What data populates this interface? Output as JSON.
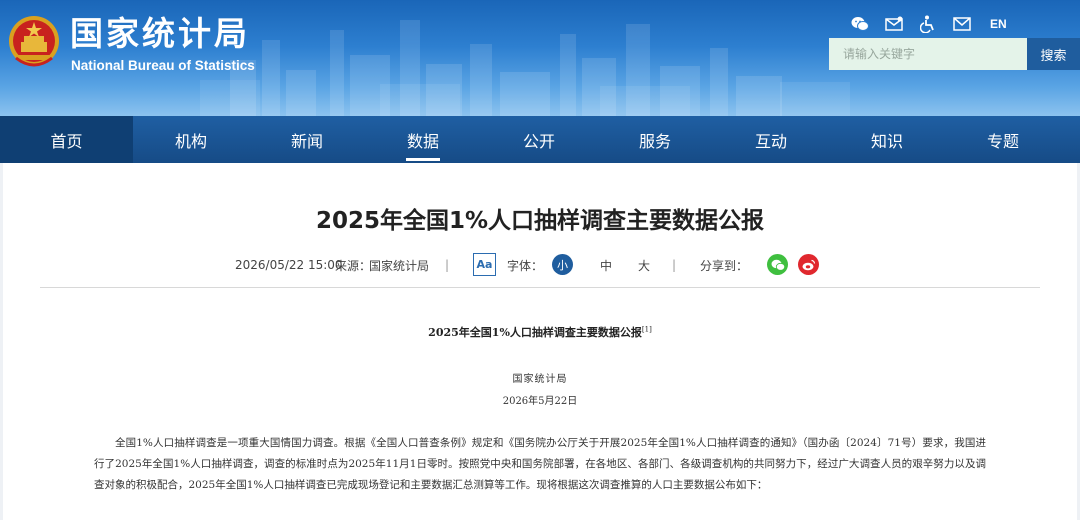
{
  "header": {
    "site_title": "国家统计局",
    "site_subtitle": "National Bureau of Statistics",
    "lang_switch": "EN",
    "icons": [
      "wechat-icon",
      "mail-icon",
      "accessibility-icon",
      "envelope-icon"
    ],
    "search": {
      "placeholder": "请输入关键字",
      "button_label": "搜索"
    }
  },
  "nav": {
    "items": [
      {
        "label": "首页"
      },
      {
        "label": "机构"
      },
      {
        "label": "新闻"
      },
      {
        "label": "数据"
      },
      {
        "label": "公开"
      },
      {
        "label": "服务"
      },
      {
        "label": "互动"
      },
      {
        "label": "知识"
      },
      {
        "label": "专题"
      }
    ],
    "active_index": 3
  },
  "article": {
    "title": "2025年全国1%人口抽样调查主要数据公报",
    "meta": {
      "date": "2026/05/22 15:00",
      "source_label": "来源：",
      "source_value": "国家统计局",
      "separator": "|",
      "aa_icon_label": "Aa",
      "font_label": "字体：",
      "font_small": "小",
      "font_medium": "中",
      "font_large": "大",
      "share_label": "分享到："
    },
    "doc_title": "2025年全国1%人口抽样调查主要数据公报",
    "doc_title_note": "[1]",
    "author": "国家统计局",
    "doc_date": "2026年5月22日",
    "body": "全国1%人口抽样调查是一项重大国情国力调查。根据《全国人口普查条例》规定和《国务院办公厅关于开展2025年全国1%人口抽样调查的通知》（国办函〔2024〕71号）要求，我国进行了2025年全国1%人口抽样调查，调查的标准时点为2025年11月1日零时。按照党中央和国务院部署，在各地区、各部门、各级调查机构的共同努力下，经过广大调查人员的艰辛努力以及调查对象的积极配合，2025年全国1%人口抽样调查已完成现场登记和主要数据汇总测算等工作。现将根据这次调查推算的人口主要数据公布如下："
  },
  "colors": {
    "header_blue": "#1a66b8",
    "nav_blue": "#164b86",
    "accent": "#1f5d9e",
    "wechat_green": "#3fbf3f",
    "weibo_red": "#e0282e"
  }
}
